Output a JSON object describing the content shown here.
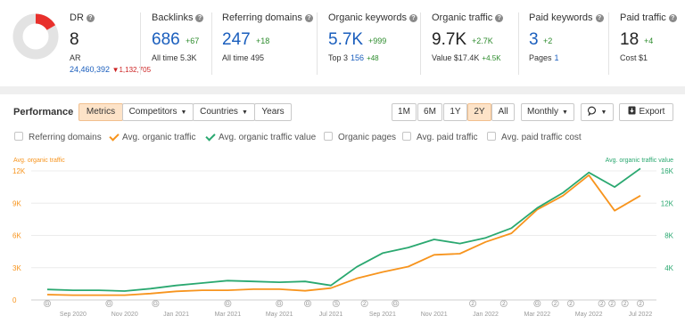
{
  "metrics": {
    "dr": {
      "title": "DR",
      "value": "8",
      "ar_label": "AR",
      "ar_value": "24,460,392",
      "ar_delta": "1,132,705"
    },
    "backlinks": {
      "title": "Backlinks",
      "value": "686",
      "delta": "+67",
      "sub_label": "All time",
      "sub_value": "5.3K"
    },
    "referring_domains": {
      "title": "Referring domains",
      "value": "247",
      "delta": "+18",
      "sub_label": "All time",
      "sub_value": "495"
    },
    "organic_keywords": {
      "title": "Organic keywords",
      "value": "5.7K",
      "delta": "+999",
      "sub_label": "Top 3",
      "sub_value": "156",
      "sub_delta": "+48"
    },
    "organic_traffic": {
      "title": "Organic traffic",
      "value": "9.7K",
      "delta": "+2.7K",
      "sub_label": "Value",
      "sub_value": "$17.4K",
      "sub_delta": "+4.5K"
    },
    "paid_keywords": {
      "title": "Paid keywords",
      "value": "3",
      "delta": "+2",
      "sub_label": "Pages",
      "sub_value": "1"
    },
    "paid_traffic": {
      "title": "Paid traffic",
      "value": "18",
      "delta": "+4",
      "sub_label": "Cost",
      "sub_value": "$1"
    }
  },
  "colors": {
    "accent_orange": "#f7941d",
    "accent_green": "#2aa870",
    "link_blue": "#1a5ebd",
    "positive": "#2c8b2c",
    "negative": "#cc2222"
  },
  "performance": {
    "title": "Performance",
    "tabs": [
      "Metrics",
      "Competitors",
      "Countries",
      "Years"
    ],
    "ranges": [
      "1M",
      "6M",
      "1Y",
      "2Y",
      "All"
    ],
    "active_range": "2Y",
    "interval": "Monthly",
    "export_label": "Export",
    "legend": [
      {
        "label": "Referring domains",
        "checked": false
      },
      {
        "label": "Avg. organic traffic",
        "checked": true,
        "color": "#f7941d"
      },
      {
        "label": "Avg. organic traffic value",
        "checked": true,
        "color": "#2aa870"
      },
      {
        "label": "Organic pages",
        "checked": false
      },
      {
        "label": "Avg. paid traffic",
        "checked": false
      },
      {
        "label": "Avg. paid traffic cost",
        "checked": false
      }
    ],
    "left_axis_title": "Avg. organic traffic",
    "right_axis_title": "Avg. organic traffic value"
  },
  "chart_data": {
    "type": "line",
    "x": [
      "Aug 2020",
      "Sep 2020",
      "Oct 2020",
      "Nov 2020",
      "Dec 2020",
      "Jan 2021",
      "Feb 2021",
      "Mar 2021",
      "Apr 2021",
      "May 2021",
      "Jun 2021",
      "Jul 2021",
      "Aug 2021",
      "Sep 2021",
      "Oct 2021",
      "Nov 2021",
      "Dec 2021",
      "Jan 2022",
      "Feb 2022",
      "Mar 2022",
      "Apr 2022",
      "May 2022",
      "Jun 2022",
      "Jul 2022"
    ],
    "x_tick_labels": [
      "Sep 2020",
      "Nov 2020",
      "Jan 2021",
      "Mar 2021",
      "May 2021",
      "Jul 2021",
      "Sep 2021",
      "Nov 2021",
      "Jan 2022",
      "Mar 2022",
      "May 2022",
      "Jul 2022"
    ],
    "series": [
      {
        "name": "Avg. organic traffic",
        "axis": "left",
        "color": "#f7941d",
        "values": [
          500,
          450,
          450,
          450,
          600,
          800,
          900,
          900,
          1000,
          1000,
          850,
          1100,
          2000,
          2600,
          3100,
          4200,
          4300,
          5400,
          6200,
          8400,
          9700,
          11600,
          8300,
          9700
        ]
      },
      {
        "name": "Avg. organic traffic value",
        "axis": "right",
        "color": "#2aa870",
        "values": [
          1300,
          1200,
          1200,
          1100,
          1400,
          1800,
          2100,
          2400,
          2300,
          2200,
          2300,
          1800,
          4100,
          5800,
          6500,
          7500,
          7000,
          7700,
          8900,
          11400,
          13300,
          15800,
          14000,
          16300
        ]
      }
    ],
    "y_left": {
      "ticks": [
        "0",
        "3K",
        "6K",
        "9K",
        "12K"
      ],
      "range": [
        0,
        12000
      ],
      "color": "#f7941d"
    },
    "y_right": {
      "ticks": [
        "4K",
        "8K",
        "12K",
        "16K"
      ],
      "range": [
        0,
        16000
      ],
      "color": "#2aa870"
    },
    "annotations": [
      "G",
      "G",
      "G",
      "G",
      "G",
      "G",
      "S",
      "2",
      "G",
      "2",
      "2",
      "G",
      "2",
      "2",
      "2",
      "2",
      "2",
      "2"
    ],
    "grid": true
  }
}
